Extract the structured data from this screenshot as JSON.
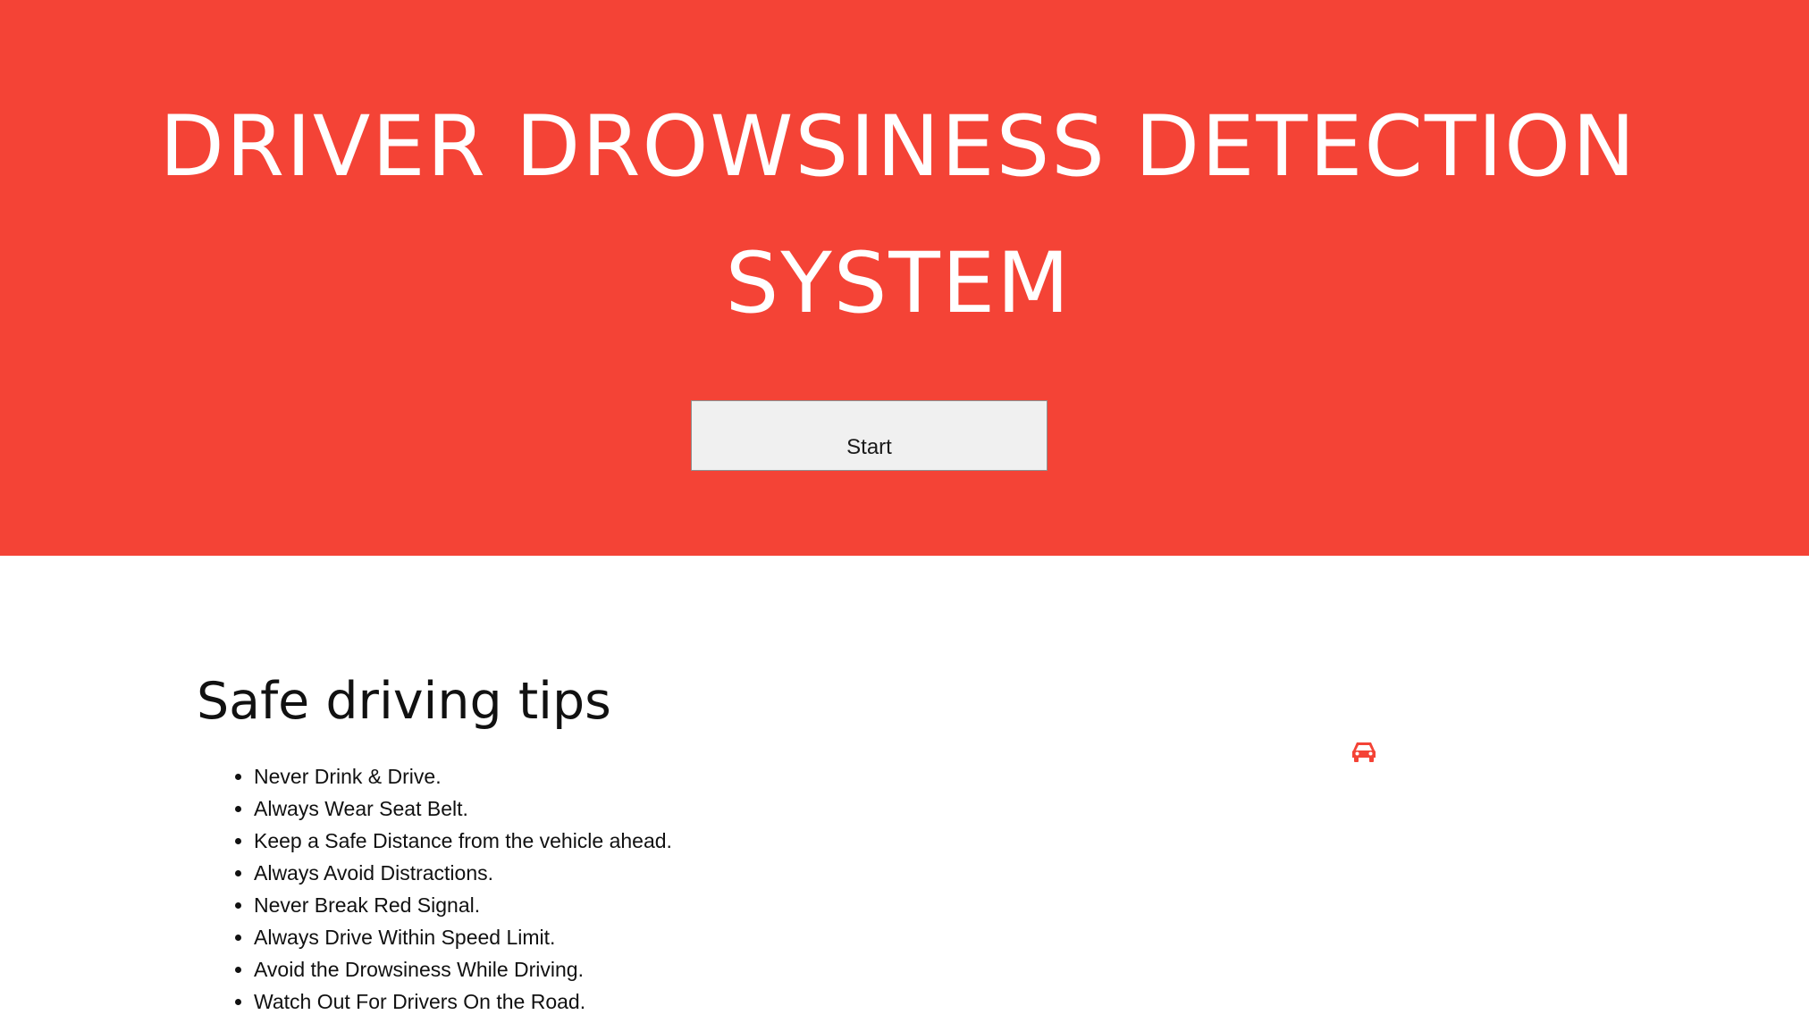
{
  "hero": {
    "title": "DRIVER DROWSINESS DETECTION SYSTEM",
    "background_color": "#f44336",
    "start_button_label": "Start"
  },
  "tips": {
    "heading": "Safe driving tips",
    "items": [
      "Never Drink & Drive.",
      "Always Wear Seat Belt.",
      "Keep a Safe Distance from the vehicle ahead.",
      "Always Avoid Distractions.",
      "Never Break Red Signal.",
      "Always Drive Within Speed Limit.",
      "Avoid the Drowsiness While Driving.",
      "Watch Out For Drivers On the Road."
    ],
    "icon": "car-icon",
    "icon_color": "#f44336"
  }
}
